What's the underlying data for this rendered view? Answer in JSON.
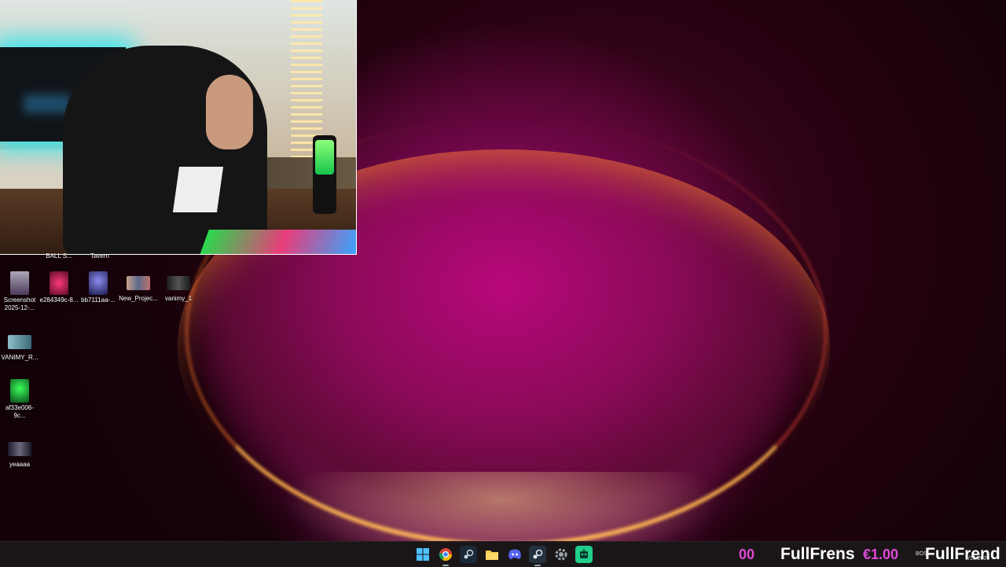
{
  "desktop": {
    "partial_labels": [
      "BALL S...",
      "Tavern"
    ],
    "icons_row": [
      {
        "label": "Screenshot 2025-12-...",
        "icon": "screenshot-file-icon",
        "color": "#6b5a7a"
      },
      {
        "label": "e284349c-8...",
        "icon": "image-file-icon",
        "color": "#c21a5a"
      },
      {
        "label": "bb7111aa-...",
        "icon": "image-file-icon",
        "color": "#3a3a8a"
      },
      {
        "label": "New_Projec...",
        "icon": "image-file-icon",
        "color": "#8a6a5a"
      },
      {
        "label": "vanimy_1",
        "icon": "image-file-icon",
        "color": "#2a2a2a"
      }
    ],
    "icons_column": [
      {
        "label": "VANIMY_R...",
        "icon": "image-file-icon",
        "color": "#5a9aa8"
      },
      {
        "label": "af33e006-9c...",
        "icon": "image-file-icon",
        "color": "#1aa82a"
      },
      {
        "label": "yeaaaa",
        "icon": "image-file-icon",
        "color": "#2a2a3a"
      }
    ]
  },
  "taskbar": {
    "apps": [
      {
        "name": "start-button",
        "icon": "windows-logo-icon",
        "glyph": "",
        "color": "#3aa7f0"
      },
      {
        "name": "chrome",
        "icon": "chrome-icon",
        "glyph": "",
        "color": "#e8453c"
      },
      {
        "name": "steam",
        "icon": "steam-icon",
        "glyph": "♨",
        "color": "#2a475e"
      },
      {
        "name": "file-explorer",
        "icon": "folder-icon",
        "glyph": "",
        "color": "#f2c14e"
      },
      {
        "name": "discord",
        "icon": "discord-icon",
        "glyph": "☺",
        "color": "#5865f2"
      },
      {
        "name": "steam-2",
        "icon": "steam-icon",
        "glyph": "♨",
        "color": "#1b2838"
      },
      {
        "name": "settings",
        "icon": "gear-icon",
        "glyph": "⚙",
        "color": "#6b6f78"
      },
      {
        "name": "app-green",
        "icon": "robot-icon",
        "glyph": "▣",
        "color": "#1fcf8a"
      }
    ],
    "ticker": {
      "text_1": "00",
      "text_2": "FullFrens",
      "text_3": "€1.00",
      "text_4": "FullFrend"
    },
    "tray": {
      "small_left": "BOS",
      "date": "1/16/2026"
    }
  }
}
